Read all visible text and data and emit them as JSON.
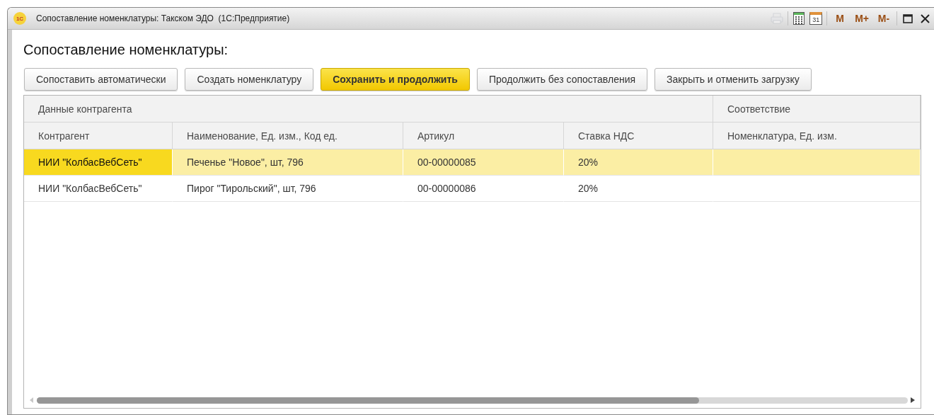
{
  "window": {
    "title": "Сопоставление номенклатуры: Такском ЭДО  (1С:Предприятие)",
    "logo": "1С",
    "tools": [
      {
        "kind": "print",
        "disabled": true
      },
      {
        "kind": "calculator",
        "disabled": false
      },
      {
        "kind": "calendar",
        "label": "31",
        "disabled": false
      },
      {
        "kind": "memory",
        "label": "M",
        "disabled": false
      },
      {
        "kind": "memory",
        "label": "M+",
        "disabled": false
      },
      {
        "kind": "memory",
        "label": "M-",
        "disabled": false
      },
      {
        "kind": "maximize",
        "disabled": false
      },
      {
        "kind": "close",
        "disabled": false
      }
    ]
  },
  "heading": "Сопоставление номенклатуры:",
  "buttons": [
    {
      "label": "Сопоставить автоматически",
      "default": false
    },
    {
      "label": "Создать номенклатуру",
      "default": false
    },
    {
      "label": "Сохранить и продолжить",
      "default": true
    },
    {
      "label": "Продолжить без сопоставления",
      "default": false
    },
    {
      "label": "Закрыть и отменить загрузку",
      "default": false
    }
  ],
  "table": {
    "groups": [
      {
        "label": "Данные контрагента"
      },
      {
        "label": "Соответствие"
      }
    ],
    "columns": [
      "Контрагент",
      "Наименование, Ед. изм., Код ед.",
      "Артикул",
      "Ставка НДС",
      "Номенклатура, Ед. изм."
    ],
    "rows": [
      {
        "selected": true,
        "cells": [
          {
            "text": "НИИ \"КолбасВебСеть\"",
            "current": true
          },
          {
            "text": "Печенье \"Новое\", шт, 796",
            "current": false
          },
          {
            "text": "00-00000085",
            "current": false
          },
          {
            "text": "20%",
            "current": false
          },
          {
            "text": "",
            "current": false
          }
        ]
      },
      {
        "selected": false,
        "cells": [
          {
            "text": "НИИ \"КолбасВебСеть\"",
            "current": false
          },
          {
            "text": "Пирог \"Тирольский\", шт, 796",
            "current": false
          },
          {
            "text": "00-00000086",
            "current": false
          },
          {
            "text": "20%",
            "current": false
          },
          {
            "text": "",
            "current": false
          }
        ]
      }
    ]
  }
}
